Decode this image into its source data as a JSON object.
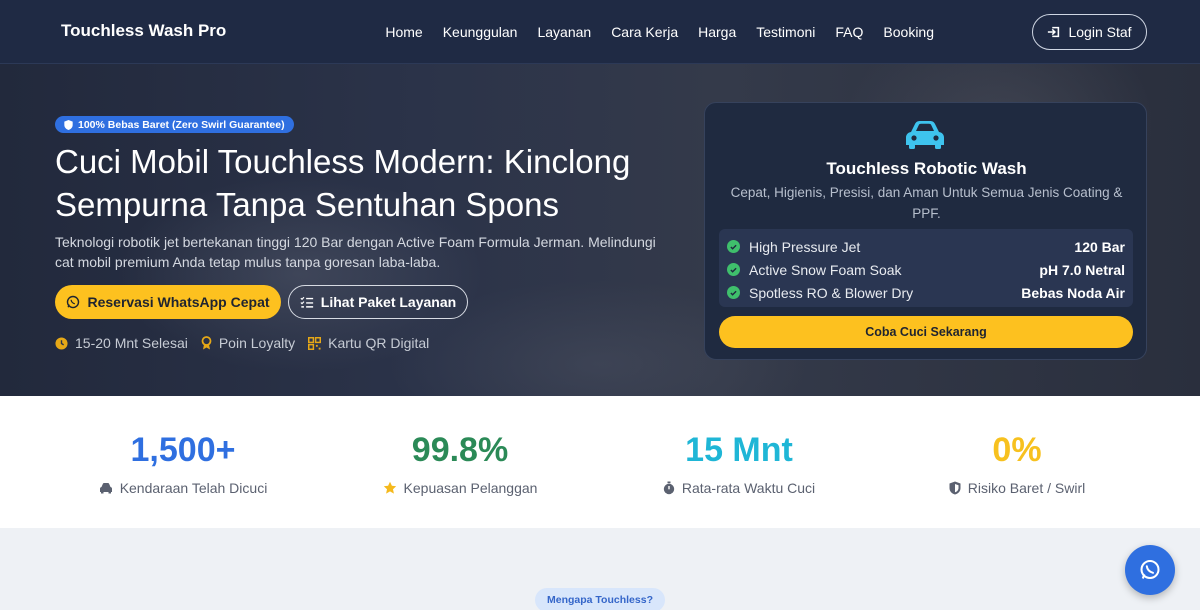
{
  "nav": {
    "brand": "Touchless Wash Pro",
    "items": [
      "Home",
      "Keunggulan",
      "Layanan",
      "Cara Kerja",
      "Harga",
      "Testimoni",
      "FAQ",
      "Booking"
    ],
    "login_label": "Login Staf"
  },
  "hero": {
    "badge": "100% Bebas Baret (Zero Swirl Guarantee)",
    "title_line1": "Cuci Mobil Touchless Modern: Kinclong",
    "title_line2": "Sempurna Tanpa Sentuhan Spons",
    "lead_line1": "Teknologi robotik jet bertekanan tinggi 120 Bar dengan Active Foam Formula Jerman. Melindungi",
    "lead_line2": "cat mobil premium Anda tetap mulus tanpa goresan laba-laba.",
    "primary_btn": "Reservasi WhatsApp Cepat",
    "secondary_btn": "Lihat Paket Layanan",
    "features": [
      "15-20 Mnt Selesai",
      "Poin Loyalty",
      "Kartu QR Digital"
    ]
  },
  "card": {
    "title": "Touchless Robotic Wash",
    "subtitle_line1": "Cepat, Higienis, Presisi, dan Aman Untuk Semua Jenis Coating &",
    "subtitle_line2": "PPF.",
    "specs": [
      {
        "label": "High Pressure Jet",
        "value": "120 Bar"
      },
      {
        "label": "Active Snow Foam Soak",
        "value": "pH 7.0 Netral"
      },
      {
        "label": "Spotless RO & Blower Dry",
        "value": "Bebas Noda Air"
      }
    ],
    "cta": "Coba Cuci Sekarang"
  },
  "stats": [
    {
      "value": "1,500+",
      "label": "Kendaraan Telah Dicuci",
      "color": "#2f6fe0"
    },
    {
      "value": "99.8%",
      "label": "Kepuasan Pelanggan",
      "color": "#2b8a57"
    },
    {
      "value": "15 Mnt",
      "label": "Rata-rata Waktu Cuci",
      "color": "#1fb6d6"
    },
    {
      "value": "0%",
      "label": "Risiko Baret / Swirl",
      "color": "#f7c11f"
    }
  ],
  "section_pill": "Mengapa Touchless?",
  "colors": {
    "accent": "#fdc11f",
    "primary": "#2f6fe0",
    "nav_bg": "#1f2a44"
  }
}
